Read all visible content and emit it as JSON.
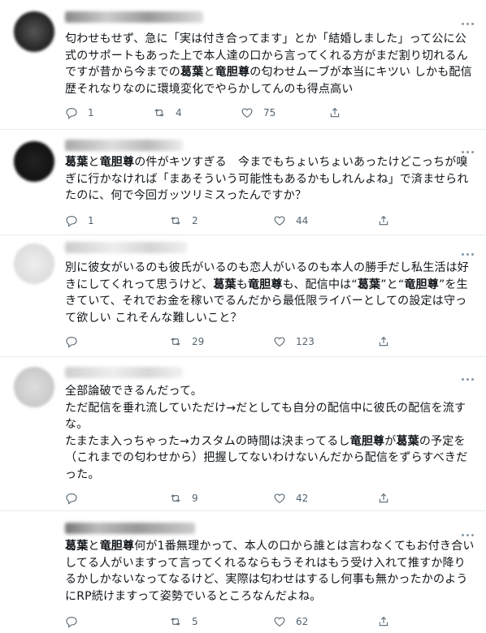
{
  "tweets": [
    {
      "avatar_color": "#333333",
      "body_parts": [
        "匂わせもせず、急に「実は付き合ってます」とか「結婚しました」って公に公式のサポートもあった上で本人達の口から言ってくれる方がまだ割り切れるんですが昔から今までの",
        "葛葉",
        "と",
        "竜胆尊",
        "の匂わせムーブが本当にキツい しかも配信歴それなりなのに環境変化でやらかしてんのも得点高い"
      ],
      "reply_count": "1",
      "retweet_count": "4",
      "like_count": "75"
    },
    {
      "avatar_color": "#1a1a1a",
      "body_parts": [
        "",
        "葛葉",
        "と",
        "竜胆尊",
        "の件がキツすぎる　今までもちょいちょいあったけどこっちが嗅ぎに行かなければ「まあそういう可能性もあるかもしれんよね」で済ませられたのに、何で今回ガッツリミスったんですか？"
      ],
      "reply_count": "1",
      "retweet_count": "2",
      "like_count": "44"
    },
    {
      "avatar_color": "#e0e0e0",
      "body_parts": [
        "別に彼女がいるのも彼氏がいるのも恋人がいるのも本人の勝手だし私生活は好きにしてくれって思うけど、",
        "葛葉",
        "も",
        "竜胆尊",
        "も、配信中は“",
        "葛葉",
        "”と“",
        "竜胆尊",
        "”を生きていて、それでお金を稼いでるんだから最低限ライバーとしての設定は守って欲しい これそんな難しいこと？"
      ],
      "reply_count": "",
      "retweet_count": "29",
      "like_count": "123"
    },
    {
      "avatar_color": "#d6d6d6",
      "body_parts": [
        "全部論破できるんだって。\nただ配信を垂れ流していただけ→だとしても自分の配信中に彼氏の配信を流すな。\nたまたま入っちゃった→カスタムの時間は決まってるし",
        "竜胆尊",
        "が",
        "葛葉",
        "の予定を（これまでの匂わせから）把握してないわけないんだから配信をずらすべきだった。"
      ],
      "reply_count": "",
      "retweet_count": "9",
      "like_count": "42"
    },
    {
      "avatar_color": "#ffffff",
      "body_parts": [
        "",
        "葛葉",
        "と",
        "竜胆尊",
        "何が1番無理かって、本人の口から誰とは言わなくてもお付き合いしてる人がいますって言ってくれるならもうそれはもう受け入れて推すか降りるかしかないなってなるけど、実際は匂わせはするし何事も無かったかのようにRP続けますって姿勢でいるところなんだよね。"
      ],
      "reply_count": "",
      "retweet_count": "5",
      "like_count": "62"
    }
  ]
}
